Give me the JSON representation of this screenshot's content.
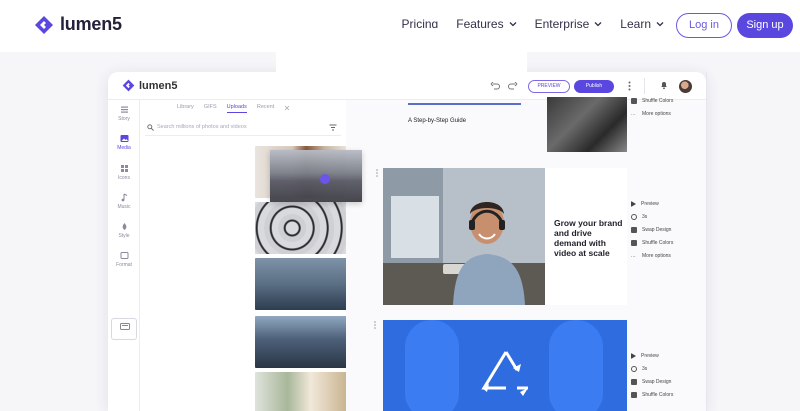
{
  "site": {
    "brand": "lumen5",
    "nav": [
      {
        "label": "Pricing",
        "has_chevron": false
      },
      {
        "label": "Features",
        "has_chevron": true
      },
      {
        "label": "Enterprise",
        "has_chevron": true
      },
      {
        "label": "Learn",
        "has_chevron": true
      }
    ],
    "login_label": "Log in",
    "signup_label": "Sign up",
    "accent": "#5a47e0"
  },
  "app": {
    "brand": "lumen5",
    "preview_label": "PREVIEW",
    "publish_label": "Publish",
    "rail": [
      {
        "label": "Story",
        "icon": "story-icon"
      },
      {
        "label": "Media",
        "icon": "media-icon",
        "active": true
      },
      {
        "label": "Icons",
        "icon": "icons-icon"
      },
      {
        "label": "Music",
        "icon": "music-icon"
      },
      {
        "label": "Style",
        "icon": "style-icon"
      },
      {
        "label": "Format",
        "icon": "format-icon"
      }
    ],
    "media_tabs": [
      "Library",
      "GIFS",
      "Uploads",
      "Recent"
    ],
    "media_active_tab": "Uploads",
    "search_placeholder": "Search millions of photos and videos",
    "scene1_title": "A Step-by-Step Guide",
    "scene1_options": [
      "Shuffle Colors",
      "More options"
    ],
    "scene2_heading": "Grow your brand and drive demand with video at scale",
    "scene2_options": [
      "Preview",
      "3s",
      "Swap Design",
      "Shuffle Colors",
      "More options"
    ],
    "scene3_options": [
      "Preview",
      "3s",
      "Swap Design",
      "Shuffle Colors"
    ]
  }
}
